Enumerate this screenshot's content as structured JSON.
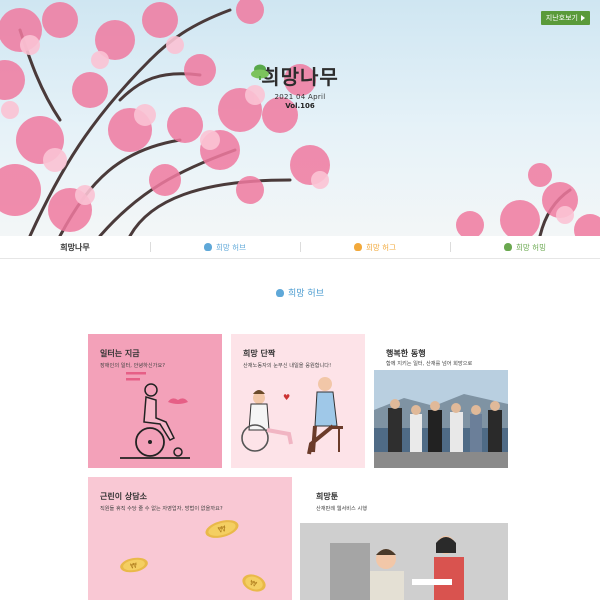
{
  "hero": {
    "prev_label": "지난호보기",
    "brand_title": "희망나무",
    "date": "2021 04 April",
    "vol": "Vol.106"
  },
  "nav": {
    "logo": "희망나무",
    "items": [
      {
        "label": "희망 허브",
        "color": "#5fa8d8"
      },
      {
        "label": "희망 허그",
        "color": "#f2a93b"
      },
      {
        "label": "희망 허밍",
        "color": "#6aa84f"
      }
    ]
  },
  "section": {
    "title": "희망 허브",
    "accent": "#4a9bd0"
  },
  "cards": [
    {
      "title": "일터는 지금",
      "sub": "장애인의 일터, 안녕하신가요?",
      "bg": "#f3a1b9"
    },
    {
      "title": "희망 단짝",
      "sub": "산재노동자의 눈부신 내일을 응원합니다!",
      "bg": "#fde3e8"
    },
    {
      "title": "행복한 동행",
      "sub": "함께 지키는 일터, 산재를 넘어 희망으로",
      "bg": "#ffffff"
    },
    {
      "title": "근린이 상담소",
      "sub": "직원들 휴직 수당 줄 수 없는 자영업자, 방법이 없을까요?",
      "bg": "#f9c8d4"
    },
    {
      "title": "희망툰",
      "sub": "산재판례 웹서비스 시행",
      "bg": "#ffffff"
    }
  ]
}
